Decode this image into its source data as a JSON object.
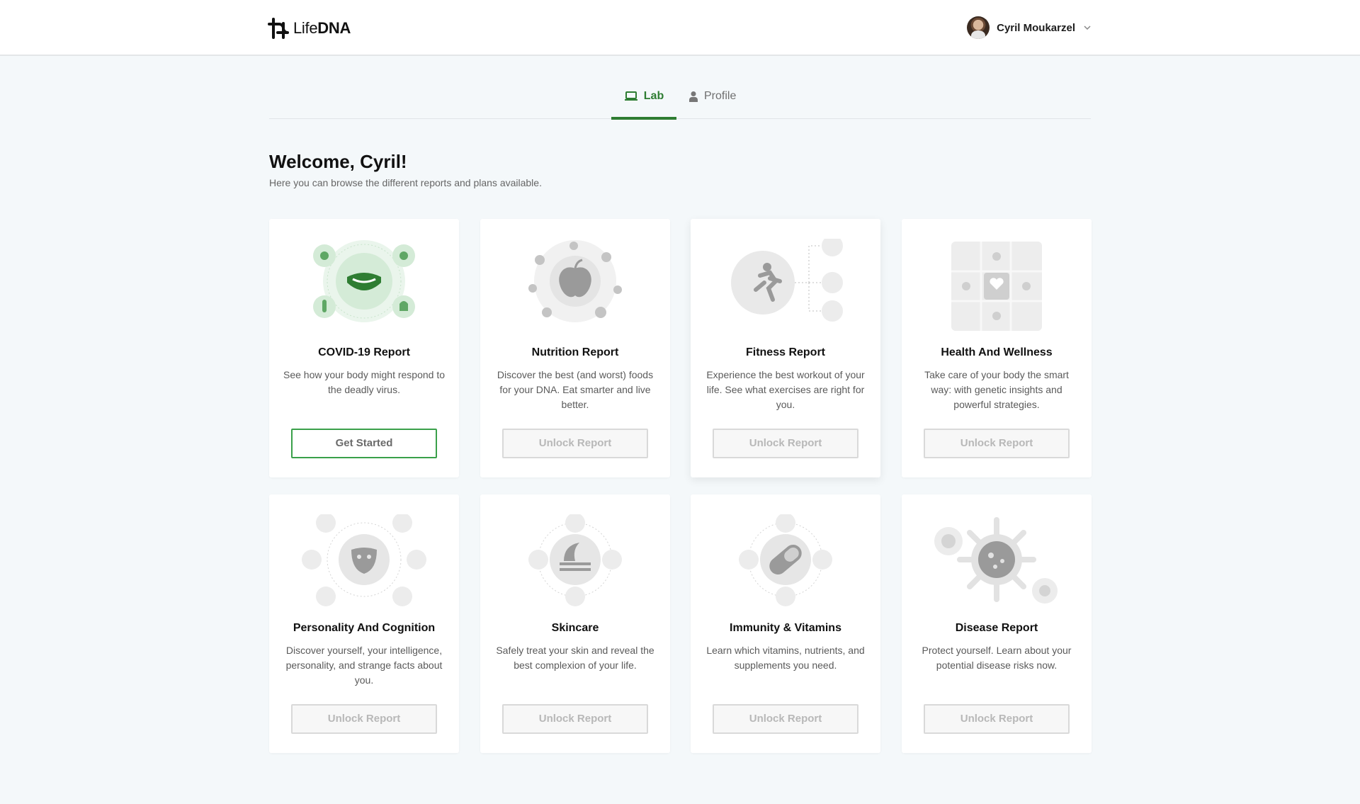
{
  "header": {
    "logo": {
      "light": "Life",
      "bold": "DNA"
    },
    "user": {
      "name": "Cyril Moukarzel"
    }
  },
  "tabs": [
    {
      "label": "Lab",
      "active": true,
      "icon": "laptop-icon"
    },
    {
      "label": "Profile",
      "active": false,
      "icon": "person-icon"
    }
  ],
  "welcome": {
    "title": "Welcome, Cyril!",
    "subtitle": "Here you can browse the different reports and plans available."
  },
  "colors": {
    "accent": "#2e7d32",
    "button_border": "#3aa04a",
    "page_bg": "#f4f8fa"
  },
  "cards": [
    {
      "title": "COVID-19 Report",
      "desc": "See how your body might respond to the deadly virus.",
      "button": "Get Started",
      "icon": "covid-mask-icon"
    },
    {
      "title": "Nutrition Report",
      "desc": "Discover the best (and worst) foods for your DNA. Eat smarter and live better.",
      "button": "Unlock Report",
      "icon": "nutrition-apple-icon"
    },
    {
      "title": "Fitness Report",
      "desc": "Experience the best workout of your life. See what exercises are right for you.",
      "button": "Unlock Report",
      "icon": "fitness-runner-icon"
    },
    {
      "title": "Health And Wellness",
      "desc": "Take care of your body the smart way: with genetic insights and powerful strategies.",
      "button": "Unlock Report",
      "icon": "health-puzzle-icon"
    },
    {
      "title": "Personality And Cognition",
      "desc": "Discover yourself, your intelligence, personality, and strange facts about you.",
      "button": "Unlock Report",
      "icon": "personality-mask-icon"
    },
    {
      "title": "Skincare",
      "desc": "Safely treat your skin and reveal the best complexion of your life.",
      "button": "Unlock Report",
      "icon": "skincare-layers-icon"
    },
    {
      "title": "Immunity & Vitamins",
      "desc": "Learn which vitamins, nutrients, and supplements you need.",
      "button": "Unlock Report",
      "icon": "vitamin-pill-icon"
    },
    {
      "title": "Disease Report",
      "desc": "Protect yourself. Learn about your potential disease risks now.",
      "button": "Unlock Report",
      "icon": "virus-icon"
    }
  ]
}
